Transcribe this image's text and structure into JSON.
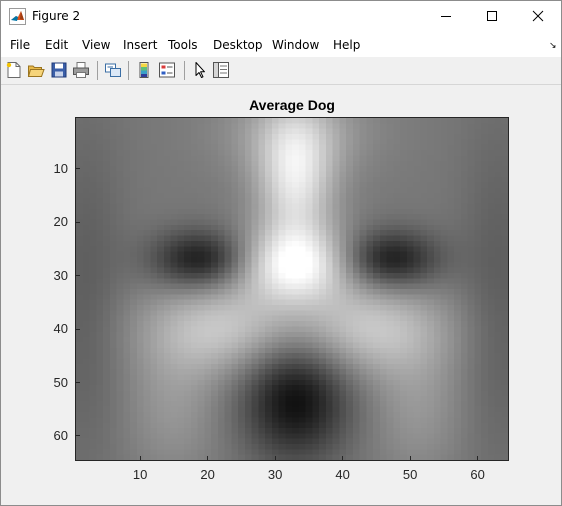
{
  "window": {
    "title": "Figure 2",
    "colors": {
      "titlebar_bg": "#ffffff",
      "figure_bg": "#f0f0f0"
    }
  },
  "menu": {
    "items": [
      "File",
      "Edit",
      "View",
      "Insert",
      "Tools",
      "Desktop",
      "Window",
      "Help"
    ]
  },
  "toolbar": {
    "tools": [
      "new-figure-icon",
      "open-file-icon",
      "save-icon",
      "print-icon",
      "link-plot-icon",
      "insert-colorbar-icon",
      "insert-legend-icon",
      "edit-plot-pointer-icon",
      "property-inspector-icon"
    ]
  },
  "chart_data": {
    "type": "heatmap",
    "title": "Average Dog",
    "colormap": "gray",
    "image_size": [
      64,
      64
    ],
    "xlim": [
      0.5,
      64.5
    ],
    "ylim": [
      0.5,
      64.5
    ],
    "y_reversed": true,
    "xticks": [
      10,
      20,
      30,
      40,
      50,
      60
    ],
    "yticks": [
      10,
      20,
      30,
      40,
      50,
      60
    ],
    "xtick_labels": [
      "10",
      "20",
      "30",
      "40",
      "50",
      "60"
    ],
    "ytick_labels": [
      "10",
      "20",
      "30",
      "40",
      "50",
      "60"
    ],
    "base_intensity": 0.47,
    "features": [
      {
        "name": "forehead-bright",
        "x": 33,
        "y": 12,
        "sx": 4,
        "sy": 9,
        "amp": 0.42
      },
      {
        "name": "upper-bright-blob",
        "x": 33,
        "y": 3,
        "sx": 8,
        "sy": 6,
        "amp": 0.16
      },
      {
        "name": "center-bright",
        "x": 33,
        "y": 28,
        "sx": 6,
        "sy": 5,
        "amp": 0.48
      },
      {
        "name": "left-cheek-bright",
        "x": 22,
        "y": 40,
        "sx": 8,
        "sy": 6,
        "amp": 0.3
      },
      {
        "name": "right-cheek-bright",
        "x": 44,
        "y": 40,
        "sx": 8,
        "sy": 6,
        "amp": 0.3
      },
      {
        "name": "left-lower-bright",
        "x": 15,
        "y": 54,
        "sx": 5,
        "sy": 9,
        "amp": 0.12
      },
      {
        "name": "right-lower-bright",
        "x": 51,
        "y": 54,
        "sx": 5,
        "sy": 9,
        "amp": 0.12
      },
      {
        "name": "left-eye",
        "x": 19,
        "y": 27,
        "sx": 5,
        "sy": 3.8,
        "amp": -0.38
      },
      {
        "name": "right-eye",
        "x": 47,
        "y": 27,
        "sx": 5,
        "sy": 3.8,
        "amp": -0.38
      },
      {
        "name": "nose-dark",
        "x": 33,
        "y": 53,
        "sx": 5.5,
        "sy": 8,
        "amp": -0.42
      },
      {
        "name": "left-edge-dark",
        "x": 2,
        "y": 33,
        "sx": 4,
        "sy": 24,
        "amp": -0.1
      },
      {
        "name": "right-edge-dark",
        "x": 63,
        "y": 33,
        "sx": 4,
        "sy": 24,
        "amp": -0.1
      }
    ]
  }
}
